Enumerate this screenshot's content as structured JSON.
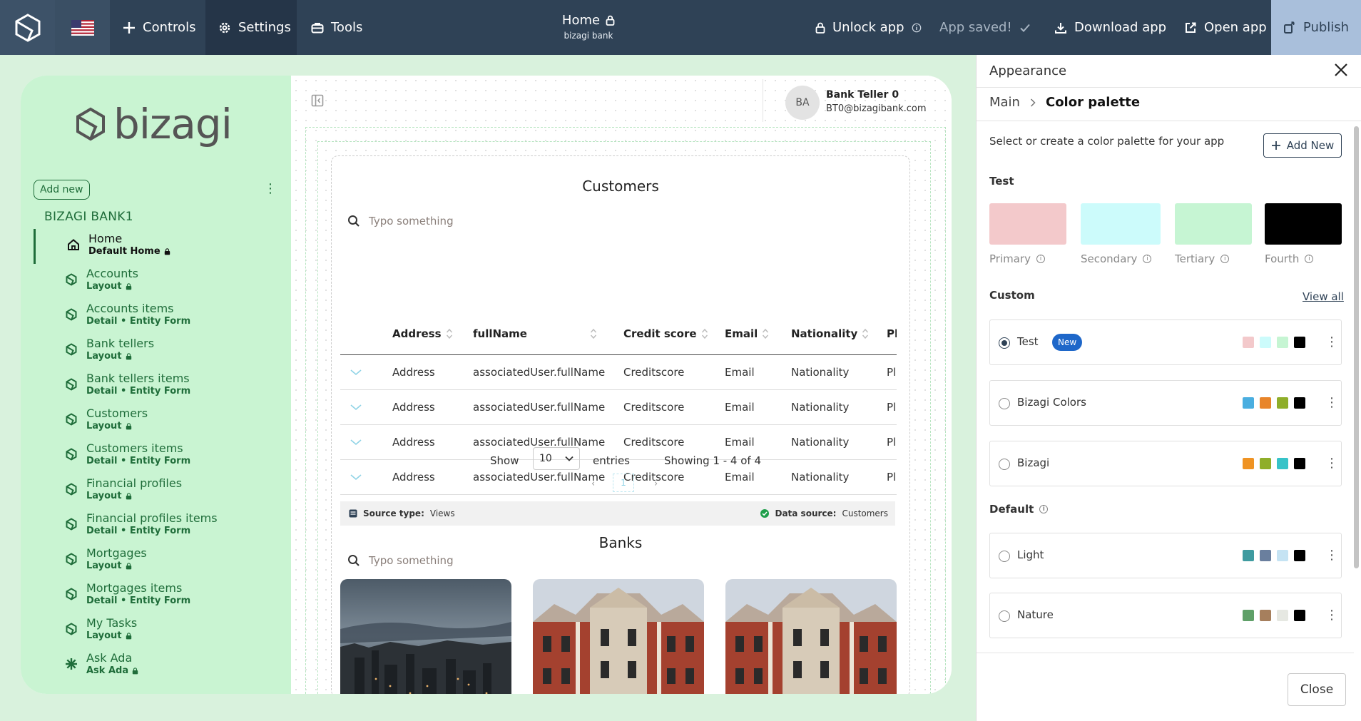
{
  "topbar": {
    "controls_label": "Controls",
    "settings_label": "Settings",
    "tools_label": "Tools",
    "page_title": "Home",
    "page_subtitle": "bizagi bank",
    "unlock_label": "Unlock app",
    "saved_label": "App saved!",
    "download_label": "Download app",
    "open_label": "Open app",
    "publish_label": "Publish"
  },
  "sidebar": {
    "logo_text": "bizagi",
    "add_new_label": "Add new",
    "group_title": "BIZAGI BANK1",
    "items": [
      {
        "label": "Home",
        "sub": "Default Home",
        "icon": "home-icon",
        "active": true
      },
      {
        "label": "Accounts",
        "sub": "Layout",
        "icon": "layout-icon"
      },
      {
        "label": "Accounts items",
        "sub": "Detail • Entity Form",
        "icon": "layout-icon"
      },
      {
        "label": "Bank tellers",
        "sub": "Layout",
        "icon": "layout-icon"
      },
      {
        "label": "Bank tellers items",
        "sub": "Detail • Entity Form",
        "icon": "layout-icon"
      },
      {
        "label": "Customers",
        "sub": "Layout",
        "icon": "layout-icon"
      },
      {
        "label": "Customers items",
        "sub": "Detail • Entity Form",
        "icon": "layout-icon"
      },
      {
        "label": "Financial profiles",
        "sub": "Layout",
        "icon": "layout-icon"
      },
      {
        "label": "Financial profiles items",
        "sub": "Detail • Entity Form",
        "icon": "layout-icon"
      },
      {
        "label": "Mortgages",
        "sub": "Layout",
        "icon": "layout-icon"
      },
      {
        "label": "Mortgages items",
        "sub": "Detail • Entity Form",
        "icon": "layout-icon"
      },
      {
        "label": "My Tasks",
        "sub": "Layout",
        "icon": "layout-icon"
      },
      {
        "label": "Ask Ada",
        "sub": "Ask Ada",
        "icon": "ada-icon"
      }
    ]
  },
  "user": {
    "initials": "BA",
    "name": "Bank Teller 0",
    "email": "BT0@bizagibank.com"
  },
  "customers": {
    "title": "Customers",
    "search_placeholder": "Typo something",
    "columns": [
      "Address",
      "fullName",
      "Credit score",
      "Email",
      "Nationality",
      "Pl"
    ],
    "rows": [
      [
        "Address",
        "associatedUser.fullName",
        "Creditscore",
        "Email",
        "Nationality",
        "Pl"
      ],
      [
        "Address",
        "associatedUser.fullName",
        "Creditscore",
        "Email",
        "Nationality",
        "Pl"
      ],
      [
        "Address",
        "associatedUser.fullName",
        "Creditscore",
        "Email",
        "Nationality",
        "Pl"
      ],
      [
        "Address",
        "associatedUser.fullName",
        "Creditscore",
        "Email",
        "Nationality",
        "Pl"
      ]
    ],
    "show_label": "Show",
    "page_size": "10",
    "entries_label": "entries",
    "showing_label": "Showing 1 - 4 of 4",
    "current_page": "1",
    "source_type_label": "Source type:",
    "source_type_value": "Views",
    "data_source_label": "Data source:",
    "data_source_value": "Customers"
  },
  "banks": {
    "title": "Banks",
    "search_placeholder": "Typo something"
  },
  "appearance": {
    "title": "Appearance",
    "crumb_main": "Main",
    "crumb_current": "Color palette",
    "description": "Select or create a color palette for your app",
    "add_new_label": "Add New",
    "test_section": "Test",
    "swatches": [
      {
        "label": "Primary",
        "color": "#f3c9cb"
      },
      {
        "label": "Secondary",
        "color": "#ccfbfb"
      },
      {
        "label": "Tertiary",
        "color": "#c6f5d3"
      },
      {
        "label": "Fourth",
        "color": "#000000"
      }
    ],
    "custom_section": "Custom",
    "view_all_label": "View all",
    "custom_palettes": [
      {
        "name": "Test",
        "badge": "New",
        "selected": true,
        "chips": [
          "#f3c9cb",
          "#ccfbfb",
          "#c6f5d3",
          "#000000"
        ]
      },
      {
        "name": "Bizagi Colors",
        "chips": [
          "#4aaee0",
          "#e8852a",
          "#8fae2a",
          "#000000"
        ]
      },
      {
        "name": "Bizagi",
        "chips": [
          "#ef9323",
          "#8fae2a",
          "#37c3c8",
          "#000000"
        ]
      }
    ],
    "default_section": "Default",
    "default_palettes": [
      {
        "name": "Light",
        "chips": [
          "#3f9ba0",
          "#6a7f9e",
          "#c5e3f3",
          "#000000"
        ]
      },
      {
        "name": "Nature",
        "chips": [
          "#5fa068",
          "#a67f5d",
          "#e6e8e2",
          "#000000"
        ]
      }
    ],
    "close_label": "Close"
  }
}
